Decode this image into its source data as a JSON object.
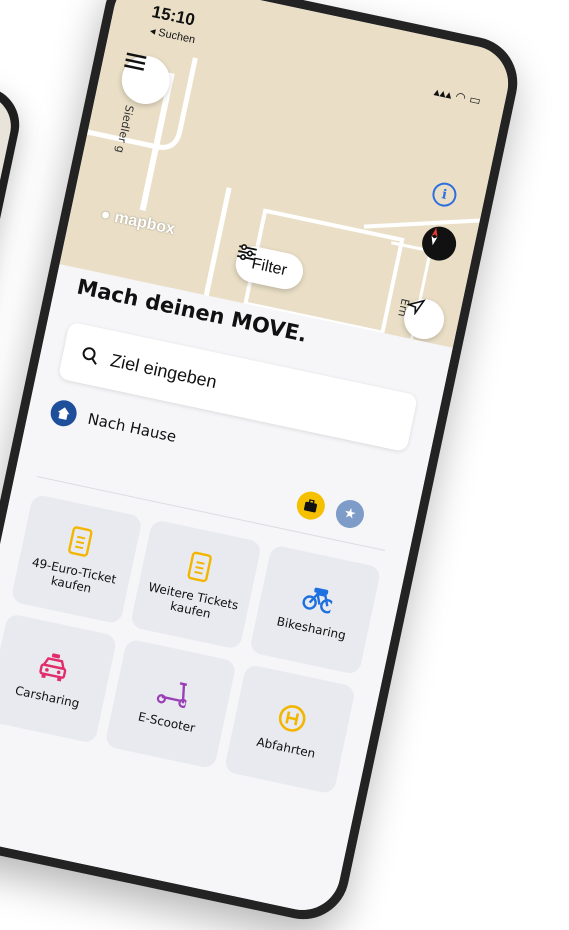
{
  "status": {
    "time": "15:10",
    "back_label": "◂ Suchen",
    "icons": "▴▴▴ ◠ ▭"
  },
  "map": {
    "street_1": "Siedler g",
    "street_2": "Ern",
    "mapbox_label": "mapbox",
    "filter_label": "Filter"
  },
  "sheet": {
    "headline": "Mach deinen MOVE.",
    "search": {
      "placeholder": "Ziel eingeben"
    },
    "home_label": "Nach Hause",
    "tiles": [
      {
        "label": "49-Euro-Ticket kaufen",
        "icon": "ticket-icon",
        "color": "#f2b600"
      },
      {
        "label": "Weitere Tickets kaufen",
        "icon": "ticket-icon",
        "color": "#f2b600"
      },
      {
        "label": "Bikesharing",
        "icon": "bike-icon",
        "color": "#1e6fe0"
      },
      {
        "label": "Carsharing",
        "icon": "car-icon",
        "color": "#e22d6b"
      },
      {
        "label": "E-Scooter",
        "icon": "scooter-icon",
        "color": "#9a3fb5"
      },
      {
        "label": "Abfahrten",
        "icon": "bus-stop-icon",
        "color": "#f2b600"
      }
    ]
  },
  "colors": {
    "map_bg": "#eadfc6",
    "accent_blue": "#2e6fe0",
    "home_blue": "#1e4f9a"
  }
}
